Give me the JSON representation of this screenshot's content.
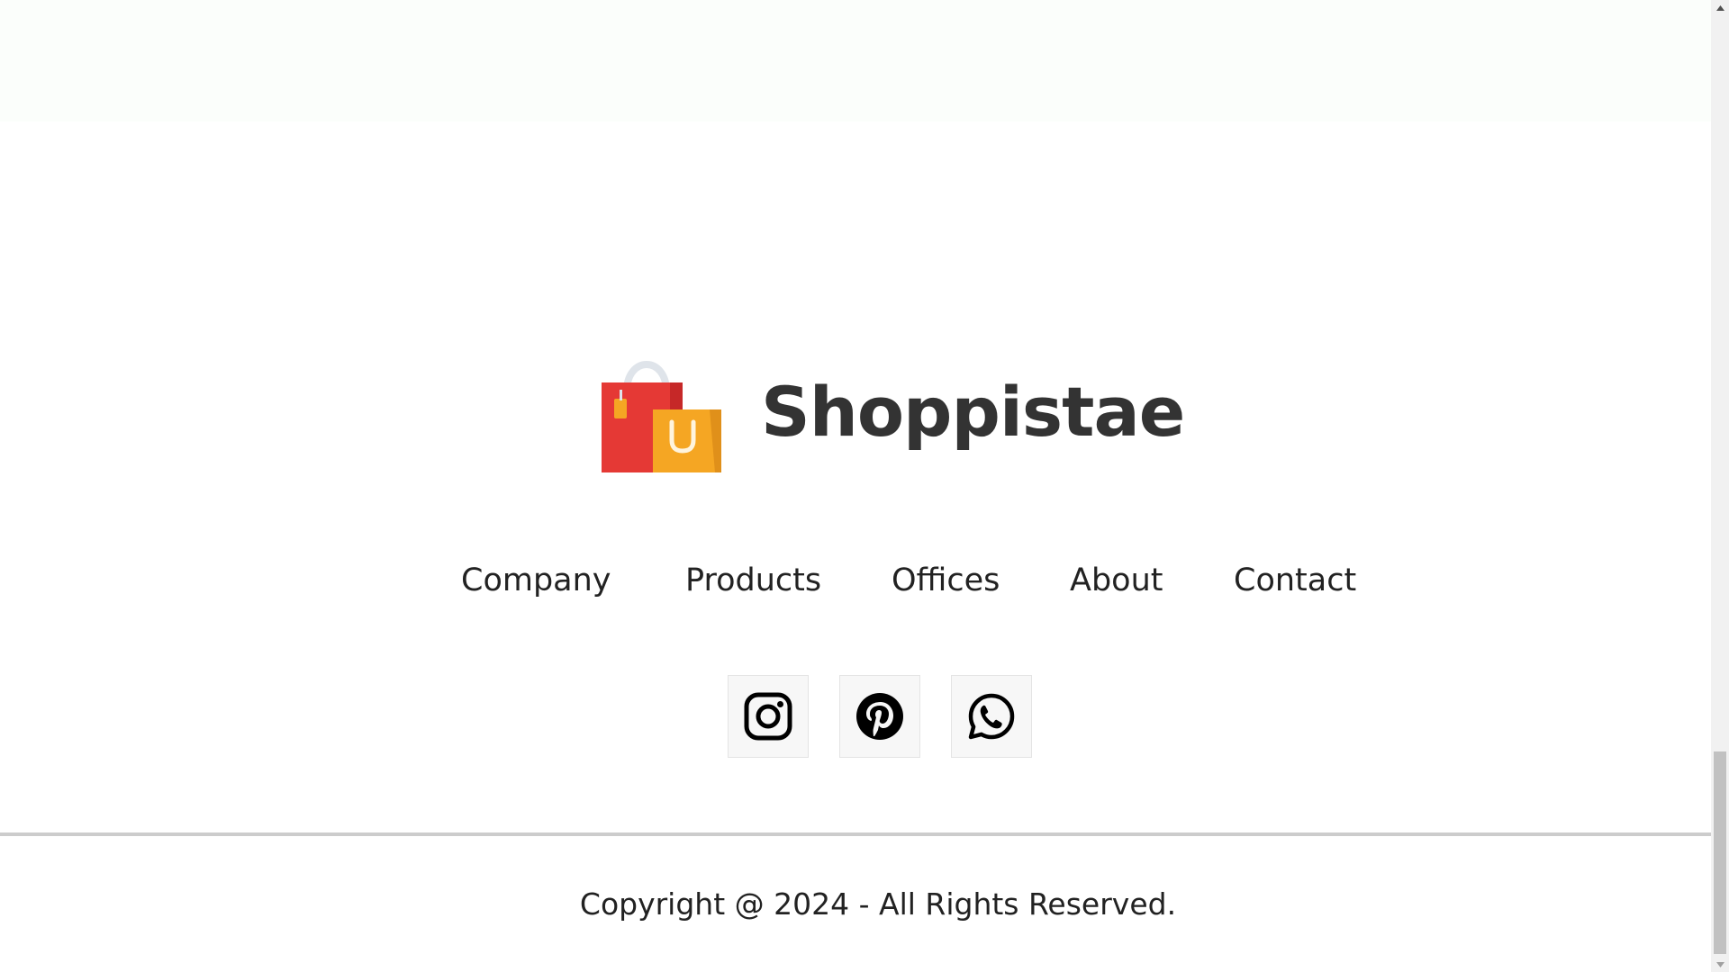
{
  "brand": {
    "name": "Shoppistae",
    "logo_icon": "shopping-bags-icon",
    "logo_letter": "U"
  },
  "nav": {
    "items": [
      {
        "label": "Company"
      },
      {
        "label": "Products"
      },
      {
        "label": "Offices"
      },
      {
        "label": "About"
      },
      {
        "label": "Contact"
      }
    ]
  },
  "socials": [
    {
      "icon": "instagram-icon"
    },
    {
      "icon": "pinterest-icon"
    },
    {
      "icon": "whatsapp-icon"
    }
  ],
  "footer": {
    "copyright": "Copyright @ 2024 - All Rights Reserved."
  },
  "colors": {
    "bag_red": "#e53935",
    "bag_orange": "#f5a623",
    "brand_text": "#333333",
    "top_band": "#fbfefb",
    "divider": "#cccccc"
  }
}
